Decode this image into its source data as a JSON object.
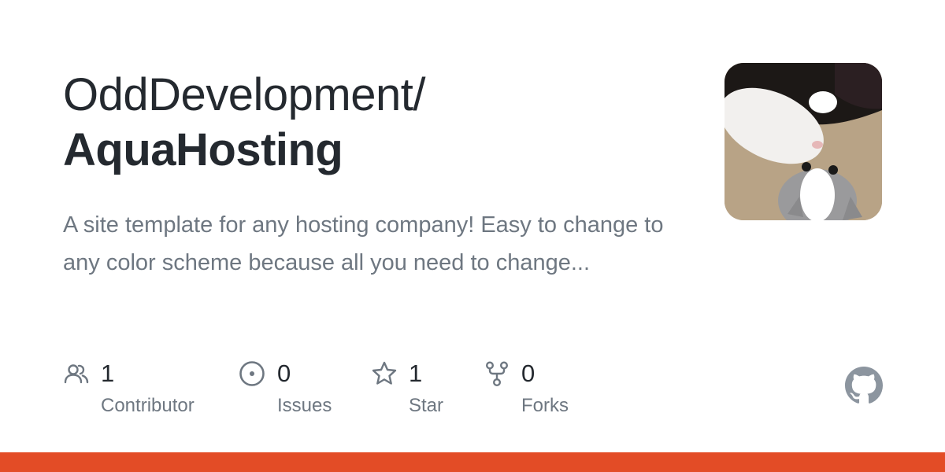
{
  "repo": {
    "owner": "OddDevelopment/",
    "name": "AquaHosting",
    "description": "A site template for any hosting company! Easy to change to any color scheme because all you need to change..."
  },
  "stats": {
    "contributors": {
      "count": "1",
      "label": "Contributor",
      "icon": "people-icon"
    },
    "issues": {
      "count": "0",
      "label": "Issues",
      "icon": "issue-opened-icon"
    },
    "stars": {
      "count": "1",
      "label": "Star",
      "icon": "star-icon"
    },
    "forks": {
      "count": "0",
      "label": "Forks",
      "icon": "repo-forked-icon"
    }
  },
  "avatar": {
    "subject": "cat photo"
  },
  "colors": {
    "text_primary": "#24292f",
    "text_secondary": "#6e7781",
    "accent_bar": "#e34c26",
    "logo": "#8c959f"
  }
}
